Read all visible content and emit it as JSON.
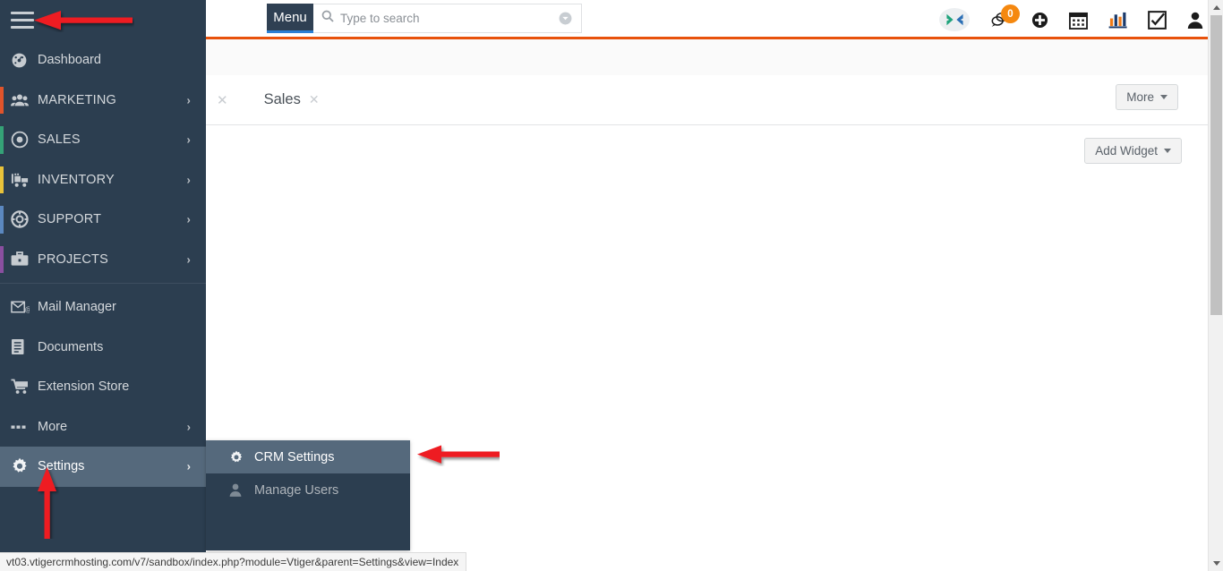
{
  "app": {
    "name": "Vtiger CRM",
    "colors": {
      "sidebar_bg": "#2c3e50",
      "sidebar_active": "#55697c",
      "accent_orange": "#e8520c",
      "menu_btn_bg": "#2f4053",
      "menu_btn_underline": "#2a7fd4",
      "badge_orange": "#f5880f",
      "annotation_red": "#ee1c20"
    }
  },
  "sidebar": {
    "hamburger_icon": "hamburger-menu-icon",
    "items": [
      {
        "label": "Dashboard",
        "icon": "dashboard-gauge-icon",
        "accent": "",
        "has_chevron": false,
        "active": false
      },
      {
        "label": "MARKETING",
        "icon": "marketing-people-icon",
        "accent": "#e0542b",
        "has_chevron": true,
        "active": false
      },
      {
        "label": "SALES",
        "icon": "sales-target-icon",
        "accent": "#35a277",
        "has_chevron": true,
        "active": false
      },
      {
        "label": "INVENTORY",
        "icon": "inventory-cart-icon",
        "accent": "#e8c23a",
        "has_chevron": true,
        "active": false
      },
      {
        "label": "SUPPORT",
        "icon": "support-lifebuoy-icon",
        "accent": "#5b88c0",
        "has_chevron": true,
        "active": false
      },
      {
        "label": "PROJECTS",
        "icon": "projects-briefcase-icon",
        "accent": "#8a4fa0",
        "has_chevron": true,
        "active": false
      }
    ],
    "items_secondary": [
      {
        "label": "Mail Manager",
        "icon": "mail-envelope-icon",
        "has_chevron": false,
        "active": false
      },
      {
        "label": "Documents",
        "icon": "documents-file-icon",
        "has_chevron": false,
        "active": false
      },
      {
        "label": "Extension Store",
        "icon": "extension-store-cart-icon",
        "has_chevron": false,
        "active": false
      },
      {
        "label": "More",
        "icon": "more-dots-icon",
        "has_chevron": true,
        "active": false
      },
      {
        "label": "Settings",
        "icon": "settings-gear-icon",
        "has_chevron": true,
        "active": true
      }
    ]
  },
  "submenu": {
    "items": [
      {
        "label": "CRM Settings",
        "icon": "settings-gear-icon",
        "active": true
      },
      {
        "label": "Manage Users",
        "icon": "user-person-icon",
        "active": false
      }
    ]
  },
  "header": {
    "menu_button_label": "Menu",
    "search": {
      "placeholder": "Type to search",
      "value": "",
      "search_icon": "magnifier-icon",
      "dropdown_icon": "chevron-down-circle-icon"
    },
    "icons": [
      {
        "name": "vtiger-logo-icon",
        "badge": ""
      },
      {
        "name": "chat-bubble-icon",
        "badge": "0"
      },
      {
        "name": "plus-circle-icon",
        "badge": ""
      },
      {
        "name": "calendar-icon",
        "badge": ""
      },
      {
        "name": "bar-chart-icon",
        "badge": ""
      },
      {
        "name": "checkbox-task-icon",
        "badge": ""
      },
      {
        "name": "user-profile-icon",
        "badge": ""
      }
    ]
  },
  "main": {
    "tab_label": "Sales",
    "tab_close_icon": "close-x-icon",
    "tab_left_close_icon": "close-x-icon",
    "more_button_label": "More",
    "add_widget_button_label": "Add Widget"
  },
  "statusbar": {
    "url": "vt03.vtigercrmhosting.com/v7/sandbox/index.php?module=Vtiger&parent=Settings&view=Index"
  },
  "scrollbar": {
    "up_arrow_icon": "scroll-up-arrow-icon",
    "down_arrow_icon": "scroll-down-arrow-icon",
    "thumb": "scroll-thumb"
  },
  "annotations": [
    {
      "name": "arrow-pointing-to-hamburger",
      "direction": "left"
    },
    {
      "name": "arrow-pointing-to-settings",
      "direction": "up"
    },
    {
      "name": "arrow-pointing-to-crm-settings",
      "direction": "left"
    }
  ]
}
